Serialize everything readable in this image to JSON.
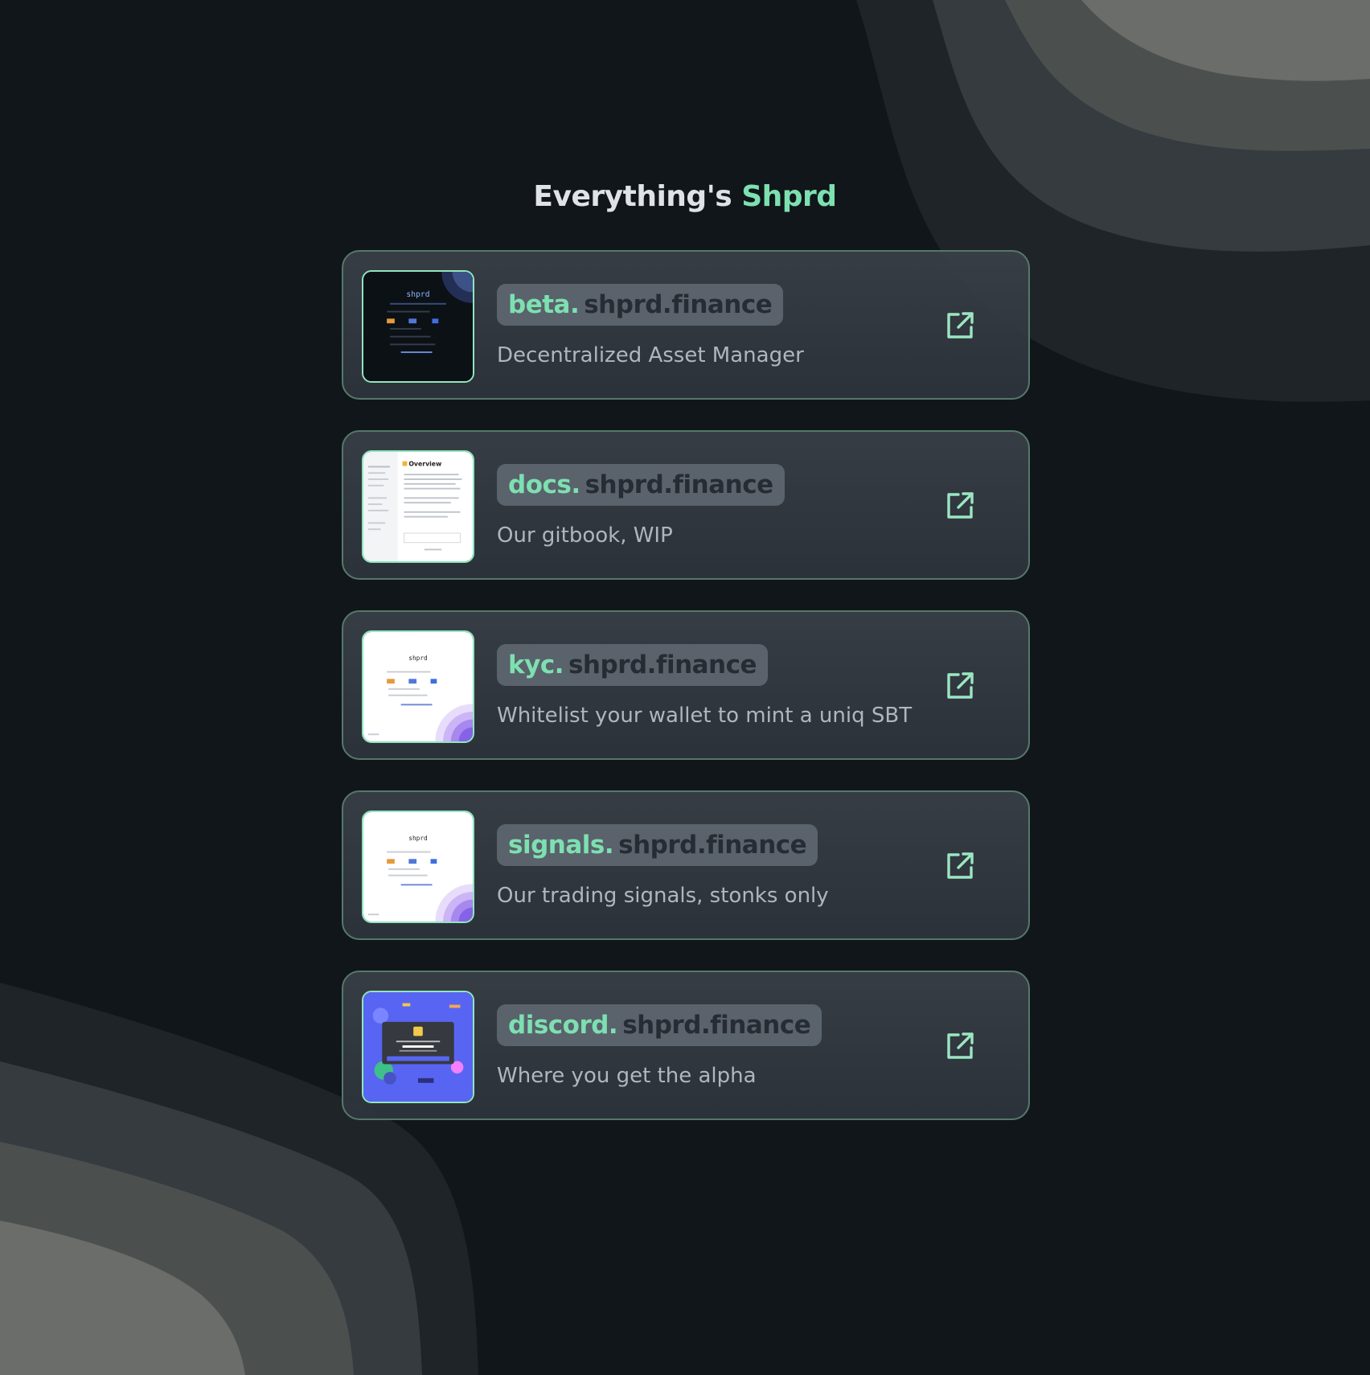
{
  "header": {
    "title_prefix": "Everything's",
    "title_accent": "Shprd"
  },
  "colors": {
    "background": "#11161a",
    "accent": "#7de0b0",
    "card_border": "#55786a",
    "pill_background": "#5a626c",
    "description_text": "#aeb6bf"
  },
  "links": [
    {
      "subdomain": "beta.",
      "domain": "shprd.finance",
      "description": "Decentralized Asset Manager",
      "thumbnail": "dark-app-preview",
      "icon": "external-link-icon"
    },
    {
      "subdomain": "docs.",
      "domain": "shprd.finance",
      "description": "Our gitbook, WIP",
      "thumbnail": "docs-preview",
      "icon": "external-link-icon"
    },
    {
      "subdomain": "kyc.",
      "domain": "shprd.finance",
      "description": "Whitelist your wallet to mint a uniq SBT",
      "thumbnail": "light-app-preview",
      "icon": "external-link-icon"
    },
    {
      "subdomain": "signals.",
      "domain": "shprd.finance",
      "description": "Our trading signals, stonks only",
      "thumbnail": "light-app-preview",
      "icon": "external-link-icon"
    },
    {
      "subdomain": "discord.",
      "domain": "shprd.finance",
      "description": "Where you get the alpha",
      "thumbnail": "discord-invite-preview",
      "icon": "external-link-icon"
    }
  ]
}
